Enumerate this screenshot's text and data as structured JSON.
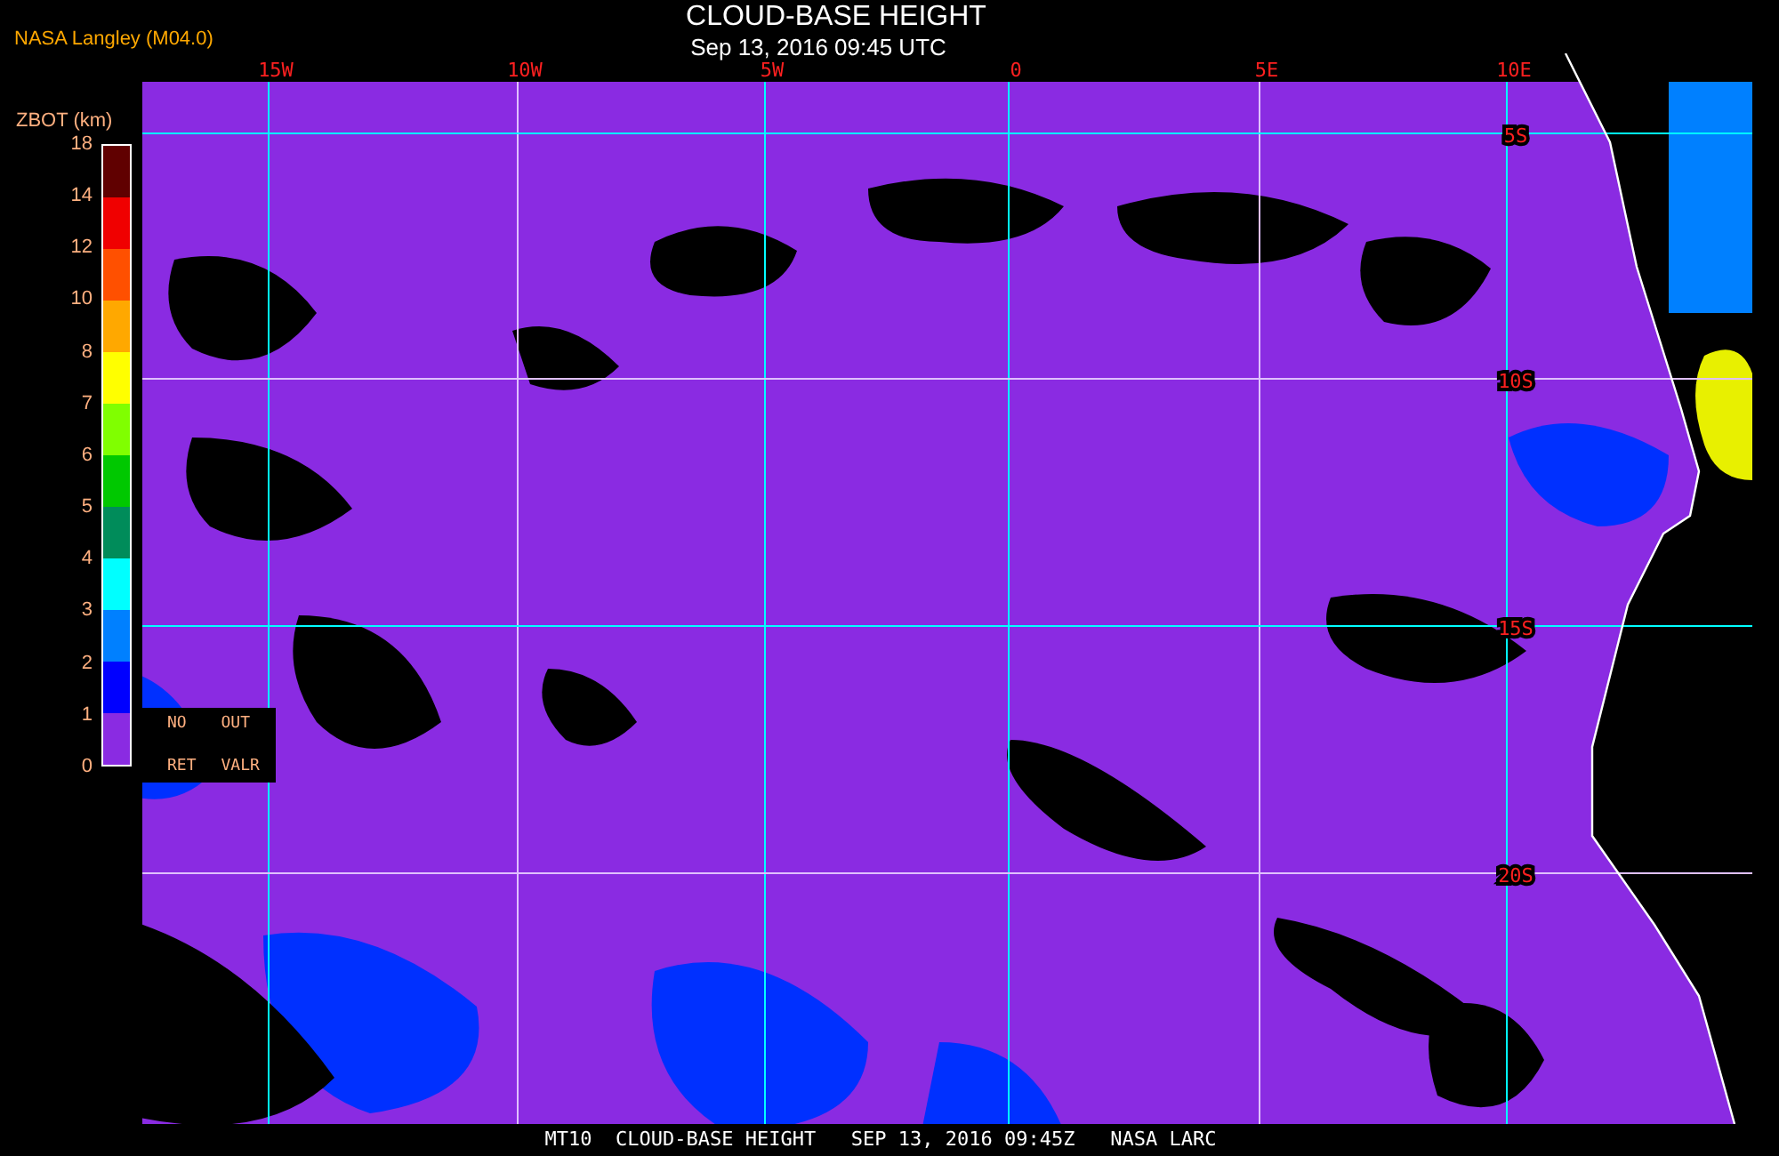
{
  "source_label": "NASA Langley (M04.0)",
  "title": "CLOUD-BASE HEIGHT",
  "subtitle": "Sep 13, 2016 09:45 UTC",
  "legend": {
    "title": "ZBOT (km)",
    "ticks": [
      "18",
      "14",
      "12",
      "10",
      "8",
      "7",
      "6",
      "5",
      "4",
      "3",
      "2",
      "1",
      "0"
    ],
    "segments": [
      {
        "color": "#600000"
      },
      {
        "color": "#f00000"
      },
      {
        "color": "#ff5000"
      },
      {
        "color": "#ffa800"
      },
      {
        "color": "#ffff00"
      },
      {
        "color": "#80ff00"
      },
      {
        "color": "#00c800"
      },
      {
        "color": "#008c5a"
      },
      {
        "color": "#00ffff"
      },
      {
        "color": "#0080ff"
      },
      {
        "color": "#0000ff"
      },
      {
        "color": "#8a2be2"
      }
    ],
    "special_labels": [
      {
        "lines": [
          "NO",
          "RET"
        ]
      },
      {
        "lines": [
          "OUT",
          "VALR"
        ]
      }
    ]
  },
  "map": {
    "longitude_labels": [
      "15W",
      "10W",
      "5W",
      "0",
      "5E",
      "10E"
    ],
    "latitude_labels": [
      "5S",
      "10S",
      "15S",
      "20S"
    ]
  },
  "footer": "MT10  CLOUD-BASE HEIGHT   SEP 13, 2016 09:45Z   NASA LARC"
}
